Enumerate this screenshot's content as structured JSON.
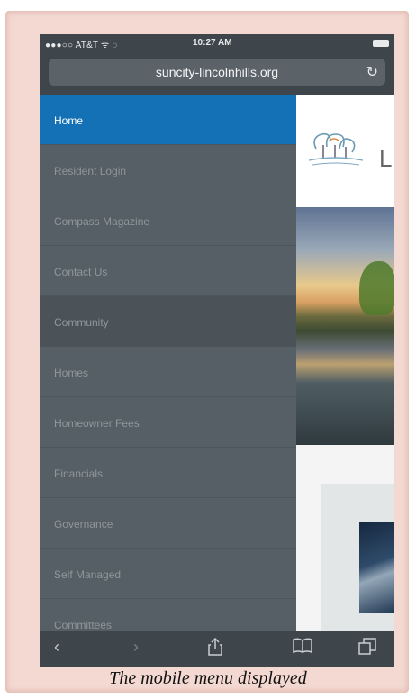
{
  "status_bar": {
    "carrier": "●●●○○ AT&T ᯤ ◌",
    "time": "10:27 AM"
  },
  "address_bar": {
    "url": "suncity-lincolnhills.org"
  },
  "menu": {
    "items": [
      {
        "label": "Home",
        "state": "active"
      },
      {
        "label": "Resident Login"
      },
      {
        "label": "Compass Magazine"
      },
      {
        "label": "Contact Us"
      },
      {
        "label": "Community",
        "state": "hover"
      },
      {
        "label": "Homes"
      },
      {
        "label": "Homeowner Fees"
      },
      {
        "label": "Financials"
      },
      {
        "label": "Governance"
      },
      {
        "label": "Self Managed"
      },
      {
        "label": "Committees"
      }
    ],
    "colors": {
      "active": "#1471b5",
      "background": "#565f65"
    }
  },
  "content": {
    "logo_partial_text": "L"
  },
  "toolbar": {
    "icons": [
      "back-icon",
      "forward-icon",
      "share-icon",
      "bookmarks-icon",
      "tabs-icon"
    ]
  },
  "caption": "The mobile menu displayed"
}
